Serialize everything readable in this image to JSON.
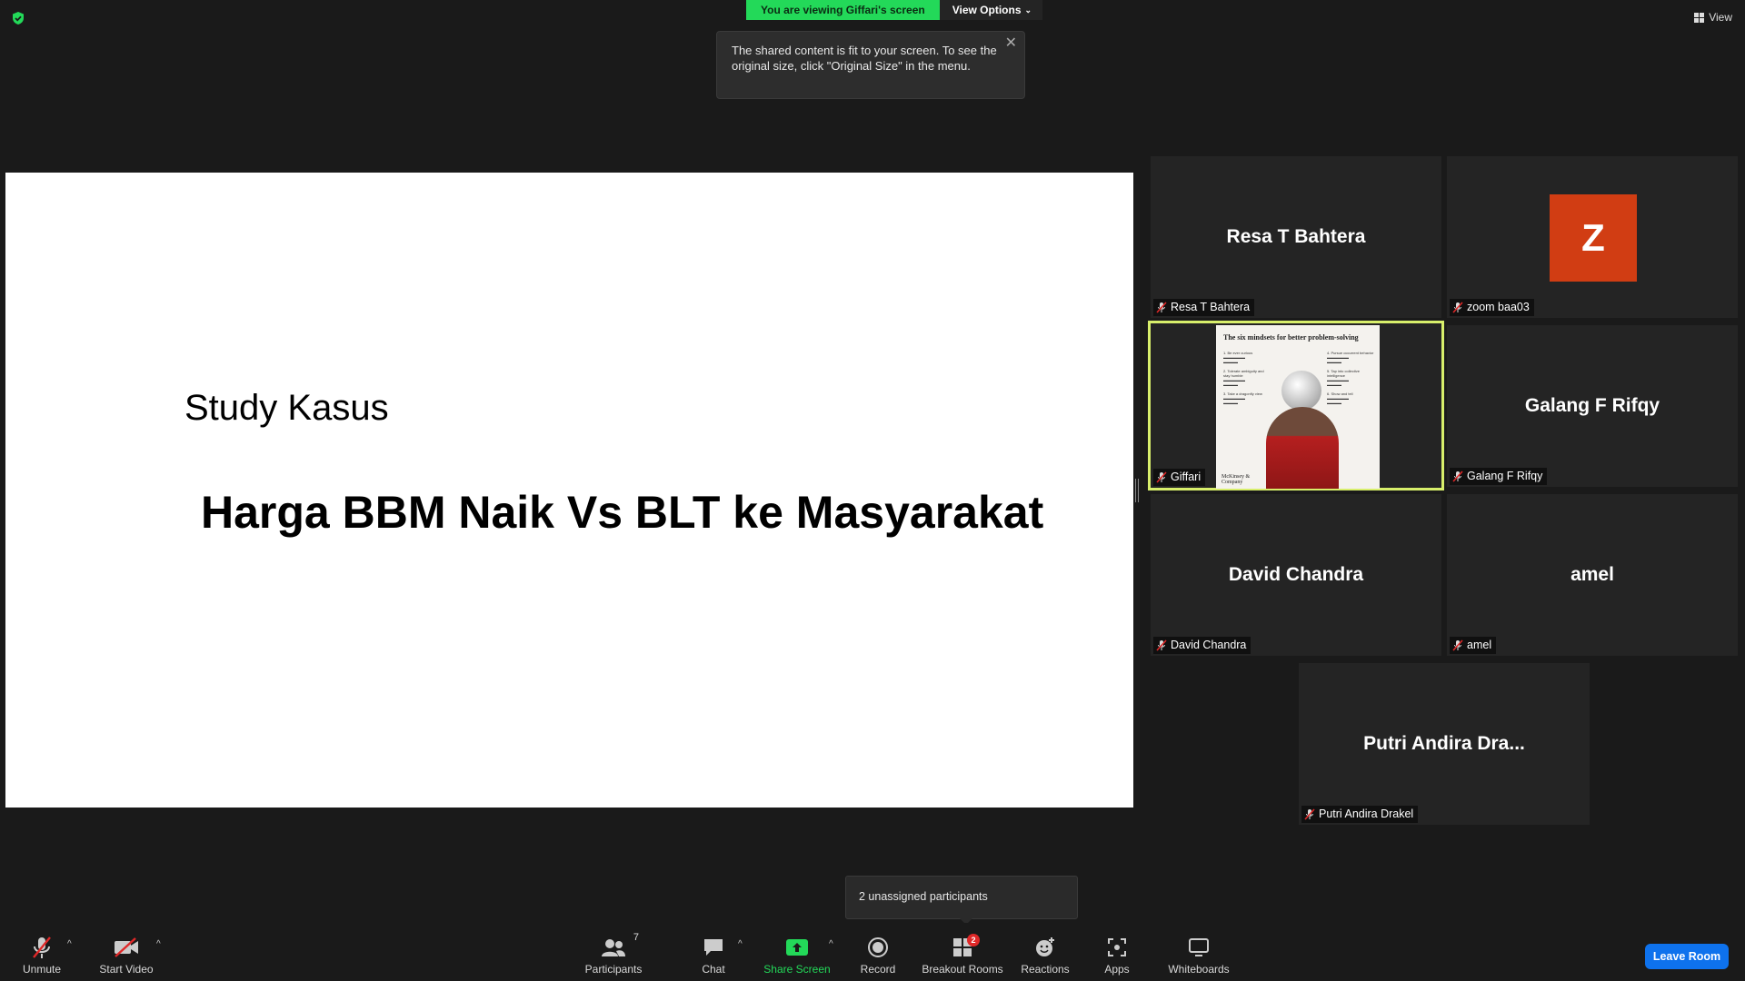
{
  "banner": {
    "viewing_text": "You are viewing Giffari's screen",
    "view_options": "View Options"
  },
  "top_right": {
    "view_label": "View"
  },
  "tooltip": {
    "text": "The shared content is fit to your screen. To see the original size, click \"Original Size\" in the menu."
  },
  "slide": {
    "subtitle": "Study Kasus",
    "headline": "Harga BBM Naik Vs BLT ke Masyarakat"
  },
  "participants": [
    {
      "display": "Resa T Bahtera",
      "label": "Resa T Bahtera"
    },
    {
      "avatar_letter": "Z",
      "label": "zoom baa03",
      "avatar_color": "#d13d13"
    },
    {
      "label": "Giffari",
      "shared_slide_title": "The six mindsets for better problem-solving",
      "shared_brand": "McKinsey & Company"
    },
    {
      "display": "Galang F Rifqy",
      "label": "Galang F Rifqy"
    },
    {
      "display": "David Chandra",
      "label": "David Chandra"
    },
    {
      "display": "amel",
      "label": "amel"
    },
    {
      "display": "Putri Andira Dra...",
      "label": "Putri Andira Drakel"
    }
  ],
  "breakout_tooltip": {
    "text": "2 unassigned participants"
  },
  "toolbar": {
    "unmute": "Unmute",
    "start_video": "Start Video",
    "participants": "Participants",
    "participants_count": "7",
    "chat": "Chat",
    "share_screen": "Share Screen",
    "record": "Record",
    "breakout_rooms": "Breakout Rooms",
    "breakout_badge": "2",
    "reactions": "Reactions",
    "apps": "Apps",
    "whiteboards": "Whiteboards",
    "leave": "Leave Room"
  },
  "colors": {
    "accent_green": "#23d959",
    "leave_blue": "#0e72ed",
    "active_border": "#d8ef6b",
    "muted_red": "#e02828"
  }
}
